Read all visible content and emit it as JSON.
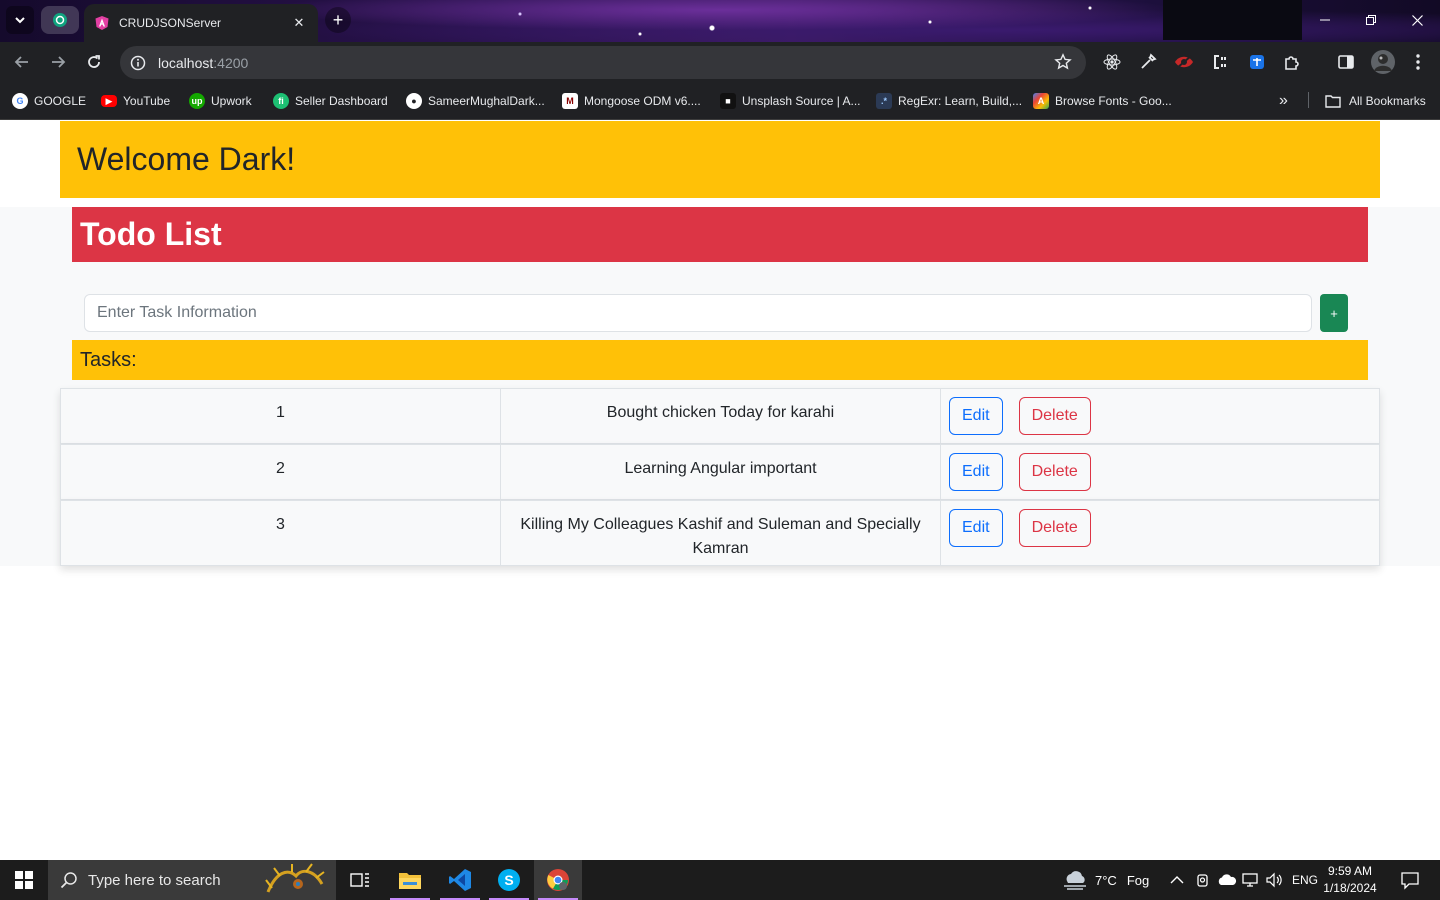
{
  "browser": {
    "active_tab_title": "CRUDJSONServer",
    "url_host": "localhost",
    "url_port": ":4200",
    "bookmarks": [
      {
        "label": "GOOGLE"
      },
      {
        "label": "YouTube"
      },
      {
        "label": "Upwork"
      },
      {
        "label": "Seller Dashboard"
      },
      {
        "label": "SameerMughalDark..."
      },
      {
        "label": "Mongoose ODM v6...."
      },
      {
        "label": "Unsplash Source | A..."
      },
      {
        "label": "RegExr: Learn, Build,..."
      },
      {
        "label": "Browse Fonts - Goo..."
      }
    ],
    "all_bookmarks_label": "All Bookmarks",
    "more_bookmarks": "»"
  },
  "page": {
    "welcome": "Welcome Dark!",
    "title": "Todo List",
    "input_placeholder": "Enter Task Information",
    "add_label": "+",
    "tasks_heading": "Tasks:",
    "tasks": [
      {
        "id": "1",
        "description": "Bought chicken Today for karahi",
        "edit_label": "Edit",
        "delete_label": "Delete"
      },
      {
        "id": "2",
        "description": "Learning Angular important",
        "edit_label": "Edit",
        "delete_label": "Delete"
      },
      {
        "id": "3",
        "description": "Killing My Colleagues Kashif and Suleman and Specially Kamran",
        "edit_label": "Edit",
        "delete_label": "Delete"
      }
    ]
  },
  "taskbar": {
    "search_placeholder": "Type here to search",
    "weather_temp": "7°C",
    "weather_desc": "Fog",
    "language": "ENG",
    "time": "9:59 AM",
    "date": "1/18/2024"
  },
  "colors": {
    "warning": "#ffc107",
    "danger": "#dc3545",
    "success": "#198754",
    "primary": "#0d6efd"
  }
}
